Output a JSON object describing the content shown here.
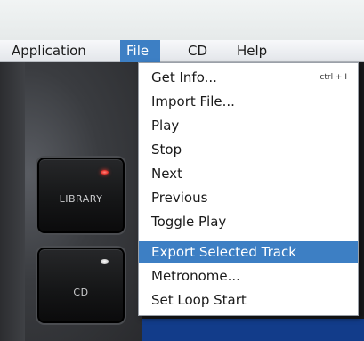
{
  "menubar": {
    "items": [
      {
        "label": "Application"
      },
      {
        "label": "File"
      },
      {
        "label": "CD"
      },
      {
        "label": "Help"
      }
    ]
  },
  "file_menu": {
    "items": [
      {
        "label": "Get Info...",
        "shortcut": "ctrl + I"
      },
      {
        "label": "Import File..."
      },
      {
        "label": "Play"
      },
      {
        "label": "Stop"
      },
      {
        "label": "Next"
      },
      {
        "label": "Previous"
      },
      {
        "label": "Toggle Play"
      },
      {
        "label": "Export Selected Track",
        "selected": true
      },
      {
        "label": "Metronome..."
      },
      {
        "label": "Set Loop Start"
      }
    ]
  },
  "buttons": {
    "library": {
      "label": "LIBRARY",
      "led_color": "#e8322c"
    },
    "cd": {
      "label": "CD",
      "led_color": "#d8d8d8"
    }
  },
  "colors": {
    "highlight": "#3d7fc4",
    "accent_blue": "#123c8a"
  }
}
